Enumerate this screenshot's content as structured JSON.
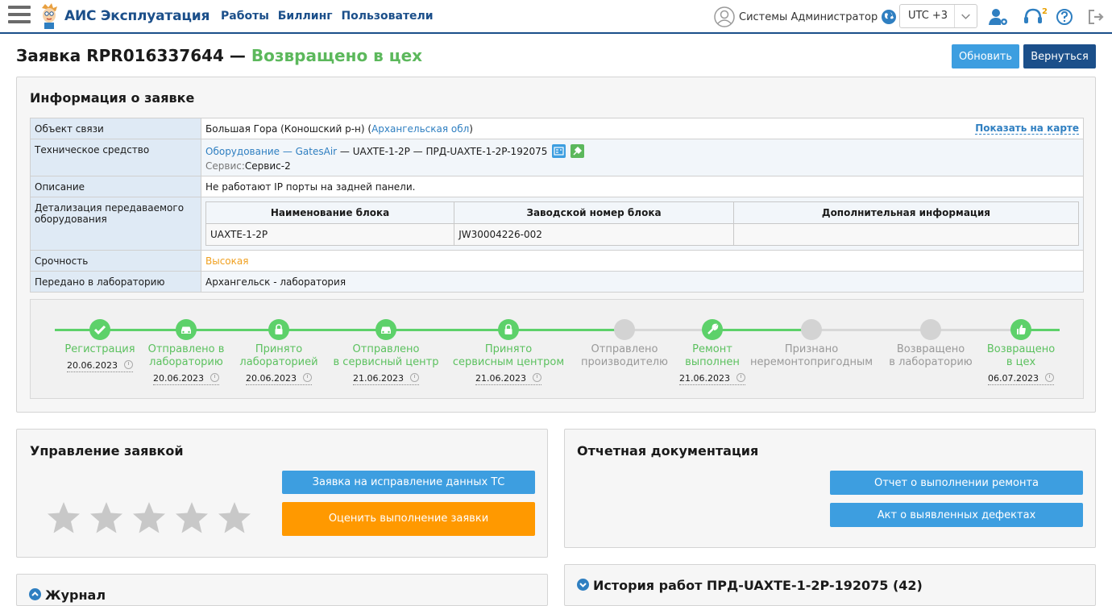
{
  "app": {
    "title": "АИС Эксплуатация"
  },
  "nav": {
    "items": [
      "Работы",
      "Биллинг",
      "Пользователи"
    ]
  },
  "user": {
    "name": "Системы Администратор",
    "timezone": "UTC +3",
    "notifications": "2"
  },
  "page": {
    "title": "Заявка RPR016337644 —",
    "status": "Возвращено в цех",
    "refresh_label": "Обновить",
    "back_label": "Вернуться"
  },
  "info": {
    "title": "Информация о заявке",
    "rows": {
      "object": {
        "label": "Объект связи",
        "value": "Большая Гора (Коношский р-н)",
        "region": "Архангельская обл",
        "map_link": "Показать на карте"
      },
      "tech": {
        "label": "Техническое средство",
        "equipment_link": "Оборудование — GatesAir",
        "equipment_rest": " — UAXTE-1-2P — ПРД-UAXTE-1-2P-192075",
        "service_label": "Сервис:",
        "service_value": "Сервис-2"
      },
      "description": {
        "label": "Описание",
        "value": "Не работают IP порты на задней панели."
      },
      "detail": {
        "label": "Детализация передаваемого оборудования",
        "headers": [
          "Наименование блока",
          "Заводской номер блока",
          "Дополнительная информация"
        ],
        "row": [
          "UAXTE-1-2P",
          "JW30004226-002",
          ""
        ]
      },
      "urgency": {
        "label": "Срочность",
        "value": "Высокая"
      },
      "lab": {
        "label": "Передано в лабораторию",
        "value": "Архангельск - лаборатория"
      }
    }
  },
  "timeline": [
    {
      "line1": "Регистрация",
      "line2": "",
      "date": "20.06.2023",
      "done": true,
      "icon": "check-icon"
    },
    {
      "line1": "Отправлено в",
      "line2": "лабораторию",
      "date": "20.06.2023",
      "done": true,
      "icon": "car-icon"
    },
    {
      "line1": "Принято",
      "line2": "лабораторией",
      "date": "20.06.2023",
      "done": true,
      "icon": "lock-icon"
    },
    {
      "line1": "Отправлено",
      "line2": "в сервисный центр",
      "date": "21.06.2023",
      "done": true,
      "icon": "car-icon"
    },
    {
      "line1": "Принято",
      "line2": "сервисным центром",
      "date": "21.06.2023",
      "done": true,
      "icon": "lock-icon"
    },
    {
      "line1": "Отправлено",
      "line2": "производителю",
      "date": "",
      "done": false,
      "icon": ""
    },
    {
      "line1": "Ремонт",
      "line2": "выполнен",
      "date": "21.06.2023",
      "done": true,
      "icon": "wrench-icon"
    },
    {
      "line1": "Признано",
      "line2": "неремонтопригодным",
      "date": "",
      "done": false,
      "icon": ""
    },
    {
      "line1": "Возвращено",
      "line2": "в лабораторию",
      "date": "",
      "done": false,
      "icon": ""
    },
    {
      "line1": "Возвращено",
      "line2": "в цех",
      "date": "06.07.2023",
      "done": true,
      "icon": "thumbs-up-icon"
    }
  ],
  "management": {
    "title": "Управление заявкой",
    "fix_label": "Заявка на исправление данных ТС",
    "rate_label": "Оценить выполнение заявки",
    "rating": 0,
    "max_rating": 5
  },
  "docs": {
    "title": "Отчетная документация",
    "report_label": "Отчет о выполнении ремонта",
    "act_label": "Акт о выявленных дефектах"
  },
  "journal": {
    "title": "Журнал"
  },
  "history": {
    "title": "История работ ПРД-UAXTE-1-2P-192075 (42)"
  },
  "colors": {
    "brand": "#1b4f8a",
    "accent": "#3d9ee0",
    "success": "#5cb85c",
    "warning": "#ff9900"
  }
}
